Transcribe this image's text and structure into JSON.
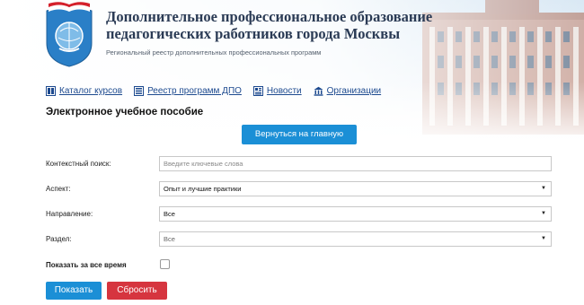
{
  "header": {
    "title_line1": "Дополнительное профессиональное образование",
    "title_line2": "педагогических работников города Москвы",
    "subtitle": "Региональный реестр дополнительных профессиональных программ"
  },
  "nav": {
    "items": [
      {
        "label": "Каталог курсов",
        "icon": "catalog-icon"
      },
      {
        "label": "Реестр программ ДПО",
        "icon": "registry-icon"
      },
      {
        "label": "Новости",
        "icon": "news-icon"
      },
      {
        "label": "Организации",
        "icon": "organizations-icon"
      }
    ]
  },
  "page": {
    "title": "Электронное учебное пособие",
    "back_button": "Вернуться на главную"
  },
  "form": {
    "search": {
      "label": "Контекстный поиск:",
      "placeholder": "Введите ключевые слова"
    },
    "aspect": {
      "label": "Аспект:",
      "value": "Опыт и лучшие практики"
    },
    "direction": {
      "label": "Направление:",
      "value": "Все"
    },
    "section": {
      "label": "Раздел:",
      "value": "Все"
    },
    "show_all_time": {
      "label": "Показать за все время",
      "checked": false
    },
    "show_button": "Показать",
    "reset_button": "Сбросить"
  },
  "colors": {
    "primary": "#1b8fd6",
    "danger": "#d6353f",
    "link": "#1d4a8f",
    "title": "#2b3b55"
  }
}
